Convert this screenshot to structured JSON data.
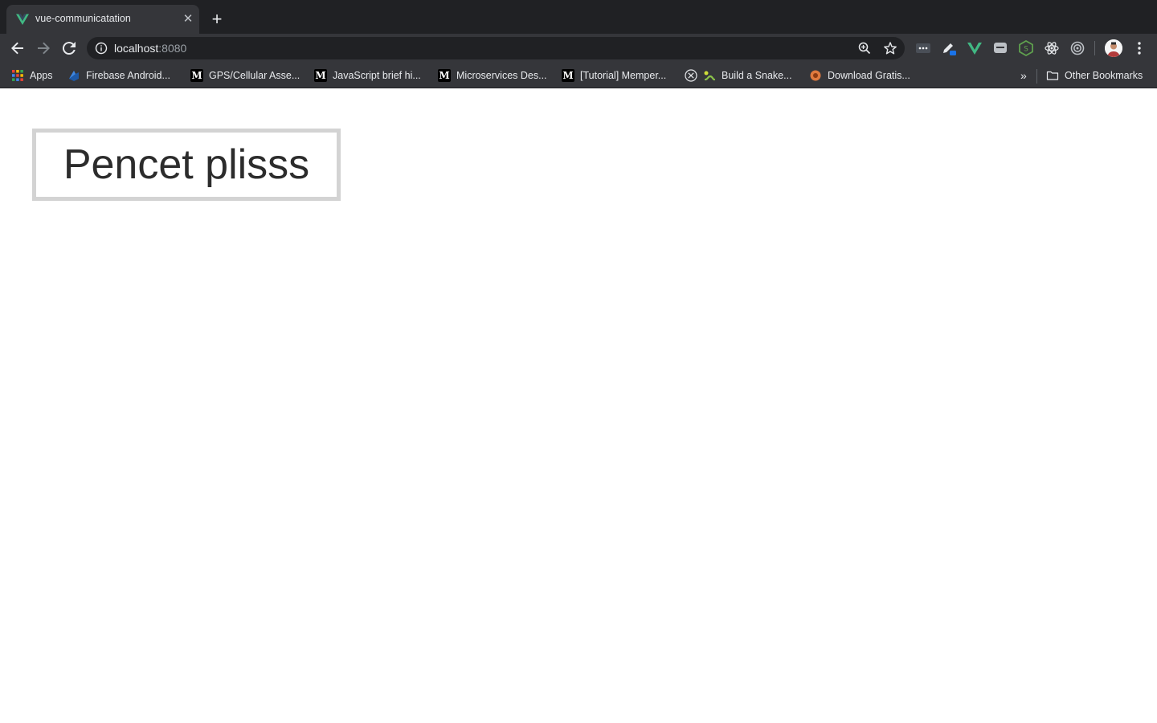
{
  "browser": {
    "tab": {
      "title": "vue-communicatation",
      "favicon": "vue-logo-icon",
      "close_glyph": "✕"
    },
    "new_tab_glyph": "+",
    "address_bar": {
      "host": "localhost",
      "port": ":8080"
    },
    "bookmarks": [
      {
        "label": "Apps",
        "icon": "apps-grid-icon"
      },
      {
        "label": "Firebase Android...",
        "icon": "firebase-icon"
      },
      {
        "label": "GPS/Cellular Asse...",
        "icon": "medium-icon"
      },
      {
        "label": "JavaScript brief hi...",
        "icon": "medium-icon"
      },
      {
        "label": "Microservices Des...",
        "icon": "medium-icon"
      },
      {
        "label": "[Tutorial] Memper...",
        "icon": "medium-icon"
      },
      {
        "label": "Build a Snake...",
        "icon": "snake-icon"
      },
      {
        "label": "Download Gratis...",
        "icon": "download-site-icon"
      }
    ],
    "bookmarks_overflow_glyph": "»",
    "other_bookmarks_label": "Other Bookmarks",
    "colors": {
      "tabstrip": "#202124",
      "toolbar": "#35363a",
      "vue_green": "#41b883",
      "vue_dark": "#35495e"
    }
  },
  "page": {
    "button_label": "Pencet plisss"
  }
}
